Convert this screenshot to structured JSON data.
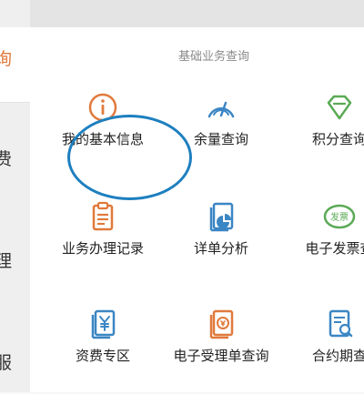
{
  "sidebar": {
    "items": [
      {
        "label": "询"
      },
      {
        "label": "费"
      },
      {
        "label": "理"
      },
      {
        "label": "服"
      }
    ]
  },
  "section": {
    "title": "基础业务查询"
  },
  "tiles": [
    {
      "label": "我的基本信息",
      "icon": "info-icon"
    },
    {
      "label": "余量查询",
      "icon": "gauge-icon"
    },
    {
      "label": "积分查询",
      "icon": "diamond-icon"
    },
    {
      "label": "业务办理记录",
      "icon": "clipboard-icon"
    },
    {
      "label": "详单分析",
      "icon": "chart-document-icon"
    },
    {
      "label": "电子发票查",
      "icon": "invoice-badge-icon"
    },
    {
      "label": "资费专区",
      "icon": "yen-document-icon"
    },
    {
      "label": "电子受理单查询",
      "icon": "receipt-document-icon"
    },
    {
      "label": "合约期查",
      "icon": "contract-search-icon"
    }
  ],
  "badge": {
    "text": "发票"
  },
  "colors": {
    "accent": "#e07a3c",
    "icon_blue": "#3b86c4",
    "icon_green": "#5aaa55",
    "ring": "#1d7fbf"
  }
}
